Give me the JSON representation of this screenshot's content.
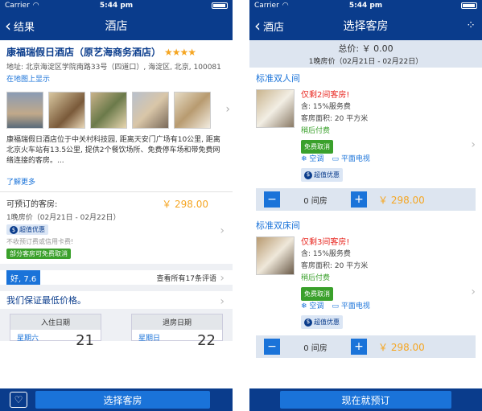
{
  "status": {
    "carrier": "Carrier",
    "time": "5:44 pm"
  },
  "colors": {
    "nav": "#0a3c8c",
    "accent": "#1a73d9",
    "price": "#f5a623",
    "green": "#3aa02b",
    "warning": "#e8261f"
  },
  "left": {
    "back_label": "结果",
    "title": "酒店",
    "hotel_name": "康福瑞假日酒店（原艺海商务酒店）",
    "stars": "★★★★",
    "address": "地址: 北京海淀区学院南路33号（四道口）, 海淀区, 北京, 100081",
    "map_link": "在地图上显示",
    "description": "康福瑞假日酒店位于中关村科技园, 距离天安门广场有10公里, 距离北京火车站有13.5公里, 提供2个餐饮场所、免费停车场和带免费网络连接的客房。...",
    "more": "了解更多",
    "rooms_label": "可预订的客房:",
    "rooms_price": "￥ 298.00",
    "one_night": "1晚房价（02月21日 - 02月22日）",
    "deal_badge": "超值优惠",
    "no_fee": "不收预订费或信用卡费!",
    "free_cancel": "部分客房可免费取消",
    "score": "好, 7.6",
    "reviews": "查看所有17条评语",
    "guarantee": "我们保证最低价格。",
    "checkin_label": "入住日期",
    "checkin_weekday": "星期六",
    "checkin_day": "21",
    "checkout_label": "退房日期",
    "checkout_weekday": "星期日",
    "checkout_day": "22",
    "select_button": "选择客房"
  },
  "right": {
    "back_label": "酒店",
    "title": "选择客房",
    "total": "总价: ￥ 0.00",
    "nights": "1晚房价（02月21日 - 02月22日）",
    "rooms": [
      {
        "name": "标准双人间",
        "warning": "仅剩2间客房!",
        "service": "含: 15%服务费",
        "area": "客房面积: 20 平方米",
        "pay_later": "稍后付费",
        "free_cancel": "免费取消",
        "aircon": "空调",
        "tv": "平面电视",
        "deal": "超值优惠",
        "qty": "0 间房",
        "price": "￥ 298.00"
      },
      {
        "name": "标准双床间",
        "warning": "仅剩3间客房!",
        "service": "含: 15%服务费",
        "area": "客房面积: 20 平方米",
        "pay_later": "稍后付费",
        "free_cancel": "免费取消",
        "aircon": "空调",
        "tv": "平面电视",
        "deal": "超值优惠",
        "qty": "0 间房",
        "price": "￥ 298.00"
      }
    ],
    "book_button": "现在就预订"
  }
}
